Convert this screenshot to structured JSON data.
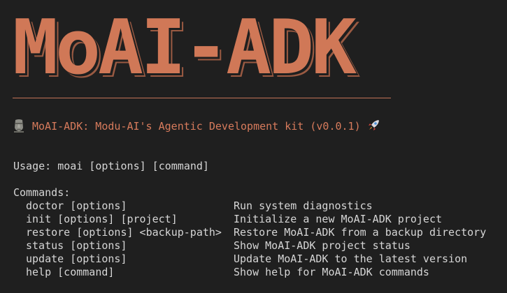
{
  "banner": {
    "text": "MoAI-ADK",
    "color": "#d07857"
  },
  "tagline": {
    "moai_icon": "moai-icon",
    "text": "MoAI-ADK: Modu-AI's Agentic Development kit (v0.0.1)",
    "rocket_icon": "rocket-icon",
    "color": "#d77b5c"
  },
  "usage": "Usage: moai [options] [command]",
  "commands_heading": "Commands:",
  "commands": [
    {
      "name": "doctor [options]",
      "description": "Run system diagnostics"
    },
    {
      "name": "init [options] [project]",
      "description": "Initialize a new MoAI-ADK project"
    },
    {
      "name": "restore [options] <backup-path>",
      "description": "Restore MoAI-ADK from a backup directory"
    },
    {
      "name": "status [options]",
      "description": "Show MoAI-ADK project status"
    },
    {
      "name": "update [options]",
      "description": "Update MoAI-ADK to the latest version"
    },
    {
      "name": "help [command]",
      "description": "Show help for MoAI-ADK commands"
    }
  ]
}
